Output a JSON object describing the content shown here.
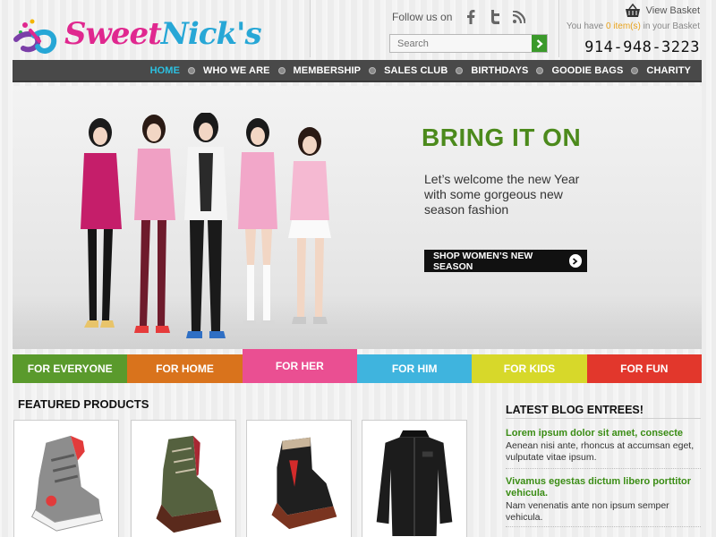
{
  "brand": {
    "name_part1": "Sweet",
    "name_part2": "Nick's"
  },
  "follow": {
    "label": "Follow us on"
  },
  "search": {
    "placeholder": "Search"
  },
  "basket": {
    "view_label": "View Basket",
    "status_prefix": "You have ",
    "status_count": "0 item(s)",
    "status_suffix": " in your Basket",
    "phone": "914-948-3223"
  },
  "nav": {
    "items": [
      {
        "label": "HOME"
      },
      {
        "label": "WHO WE ARE"
      },
      {
        "label": "MEMBERSHIP"
      },
      {
        "label": "SALES CLUB"
      },
      {
        "label": "BIRTHDAYS"
      },
      {
        "label": "GOODIE BAGS"
      },
      {
        "label": "CHARITY"
      }
    ]
  },
  "hero": {
    "title": "BRING IT ON",
    "subtitle": "Let’s welcome the new Year with some gorgeous new season fashion",
    "cta": "SHOP WOMEN’S NEW SEASON"
  },
  "tabs": [
    {
      "label": "FOR EVERYONE",
      "color": "#5a9a2c"
    },
    {
      "label": "FOR HOME",
      "color": "#d9731c"
    },
    {
      "label": "FOR HER",
      "color": "#ea4f92"
    },
    {
      "label": "FOR HIM",
      "color": "#3fb4de"
    },
    {
      "label": "FOR KIDS",
      "color": "#d7d82a"
    },
    {
      "label": "FOR FUN",
      "color": "#e2372c"
    }
  ],
  "featured": {
    "title": "FEATURED PRODUCTS",
    "products": [
      {
        "icon": "grey-high-top-sneaker-image"
      },
      {
        "icon": "olive-brown-boot-image"
      },
      {
        "icon": "black-red-boot-image"
      },
      {
        "icon": "black-jacket-image"
      }
    ]
  },
  "blog": {
    "title": "LATEST BLOG ENTREES!",
    "entries": [
      {
        "title": "Lorem ipsum dolor sit amet, consecte",
        "body": "Aenean nisi ante, rhoncus at accumsan eget, vulputate vitae ipsum."
      },
      {
        "title": "Vivamus egestas dictum libero porttitor vehicula.",
        "body": "Nam venenatis ante non ipsum semper vehicula."
      }
    ]
  },
  "colors": {
    "accent_green": "#4c8a1c",
    "nav_bg": "#494949",
    "nav_active": "#2cc0e0",
    "brand_pink": "#e0288f",
    "brand_blue": "#27a7d6"
  }
}
